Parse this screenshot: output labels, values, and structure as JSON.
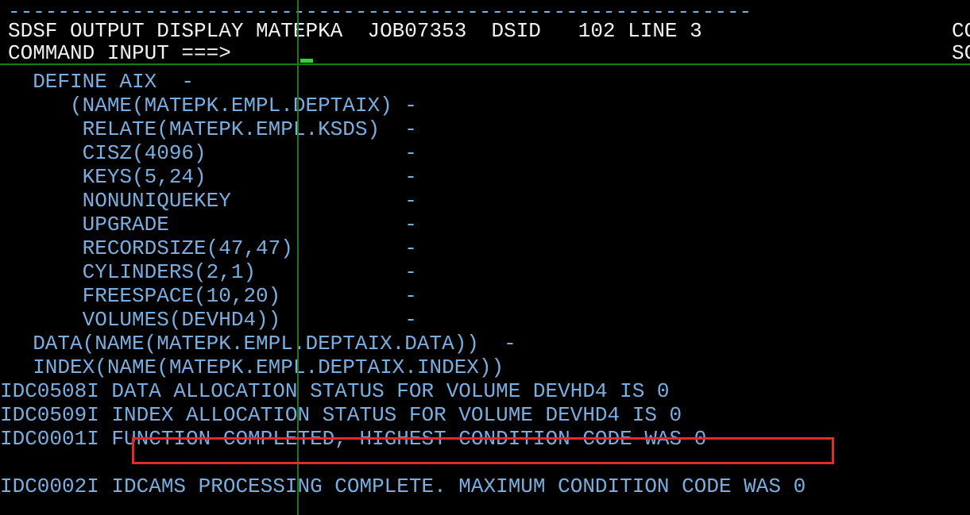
{
  "screen": {
    "background": "#000000",
    "text_white": "#f2f2f2",
    "text_blue": "#7aaee0",
    "rule_green": "#1b7a1b",
    "cursor_green": "#37d137",
    "annotation_red": "#e22b2b",
    "columns": 58,
    "rows": 22
  },
  "header": {
    "rule_line": "------------------------------------------------------------",
    "panel_title": "SDSF OUTPUT DISPLAY",
    "job_owner": "MATEPKA",
    "job_id": "JOB07353",
    "dsid_label": "DSID",
    "dsid_value": "102",
    "line_label": "LINE",
    "line_value": "3",
    "columns_label_truncated": "CO",
    "title_line": "SDSF OUTPUT DISPLAY MATEPKA  JOB07353  DSID   102 LINE 3",
    "title_right_truncated": "CO",
    "command_prompt": "COMMAND INPUT ===>",
    "command_value": "",
    "scroll_label_truncated": "SC"
  },
  "output": {
    "lines": [
      {
        "text": "  DEFINE AIX  -",
        "color": "blue"
      },
      {
        "text": "     (NAME(MATEPK.EMPL.DEPTAIX) -",
        "color": "blue"
      },
      {
        "text": "      RELATE(MATEPK.EMPL.KSDS)  -",
        "color": "blue"
      },
      {
        "text": "      CISZ(4096)                -",
        "color": "blue"
      },
      {
        "text": "      KEYS(5,24)                -",
        "color": "blue"
      },
      {
        "text": "      NONUNIQUEKEY              -",
        "color": "blue"
      },
      {
        "text": "      UPGRADE                   -",
        "color": "blue"
      },
      {
        "text": "      RECORDSIZE(47,47)         -",
        "color": "blue"
      },
      {
        "text": "      CYLINDERS(2,1)            -",
        "color": "blue"
      },
      {
        "text": "      FREESPACE(10,20)          -",
        "color": "blue"
      },
      {
        "text": "      VOLUMES(DEVHD4))          -",
        "color": "blue"
      },
      {
        "text": "  DATA(NAME(MATEPK.EMPL.DEPTAIX.DATA))  -",
        "color": "blue"
      },
      {
        "text": "  INDEX(NAME(MATEPK.EMPL.DEPTAIX.INDEX))",
        "color": "blue"
      },
      {
        "text": "IDC0508I DATA ALLOCATION STATUS FOR VOLUME DEVHD4 IS 0",
        "color": "blue"
      },
      {
        "text": "IDC0509I INDEX ALLOCATION STATUS FOR VOLUME DEVHD4 IS 0",
        "color": "blue"
      },
      {
        "text": "IDC0001I FUNCTION COMPLETED, HIGHEST CONDITION CODE WAS 0",
        "color": "blue"
      },
      {
        "text": "",
        "color": "blue"
      },
      {
        "text": "IDC0002I IDCAMS PROCESSING COMPLETE. MAXIMUM CONDITION CODE WAS 0",
        "color": "blue"
      }
    ]
  },
  "annotation": {
    "highlighted_text": "FUNCTION COMPLETED, HIGHEST CONDITION CODE WAS 0",
    "color": "#e22b2b"
  }
}
